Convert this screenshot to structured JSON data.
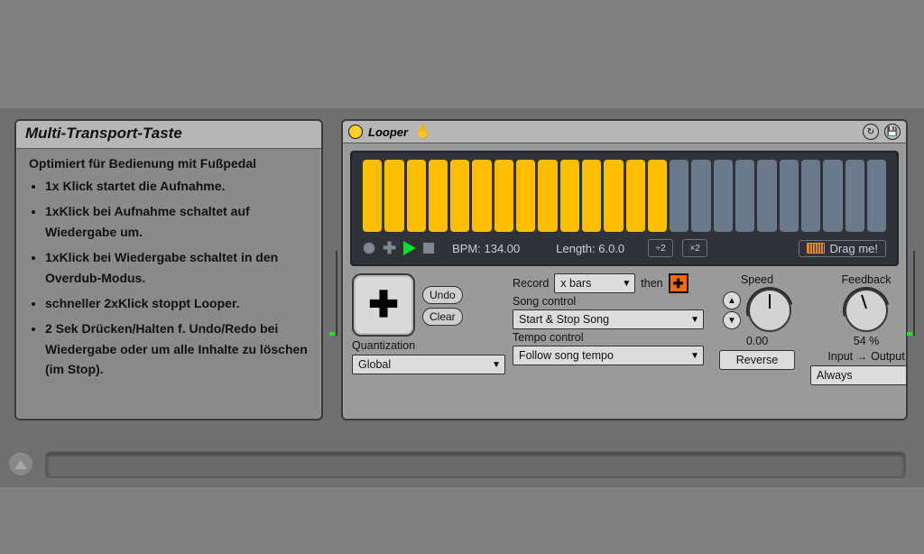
{
  "info": {
    "title": "Multi-Transport-Taste",
    "lead": "Optimiert für Bedienung mit Fußpedal",
    "items": [
      "1x Klick startet die Aufnahme.",
      "1xKlick bei Aufnahme schaltet auf Wiedergabe um.",
      "1xKlick bei Wiedergabe schaltet in den Overdub-Modus.",
      "schneller 2xKlick stoppt Looper.",
      "2 Sek Drücken/Halten f. Undo/Redo bei Wiedergabe oder um alle Inhalte zu löschen (im Stop)."
    ]
  },
  "device": {
    "name": "Looper",
    "display": {
      "bars_total": 24,
      "bars_filled": 14,
      "bpm_label": "BPM: 134.00",
      "length_label": "Length: 6.0.0",
      "half_label": "÷2",
      "double_label": "×2",
      "drag_label": "Drag me!"
    },
    "big_button_glyph": "✚",
    "undo_label": "Undo",
    "clear_label": "Clear",
    "quantization_label": "Quantization",
    "quantization_value": "Global",
    "record_label": "Record",
    "record_value": "x bars",
    "then_label": "then",
    "song_control_label": "Song control",
    "song_control_value": "Start & Stop Song",
    "tempo_control_label": "Tempo control",
    "tempo_control_value": "Follow song tempo",
    "speed_label": "Speed",
    "speed_value": "0.00",
    "reverse_label": "Reverse",
    "feedback_label": "Feedback",
    "feedback_value": "54 %",
    "input_label": "Input",
    "output_label": "Output",
    "io_value": "Always"
  }
}
